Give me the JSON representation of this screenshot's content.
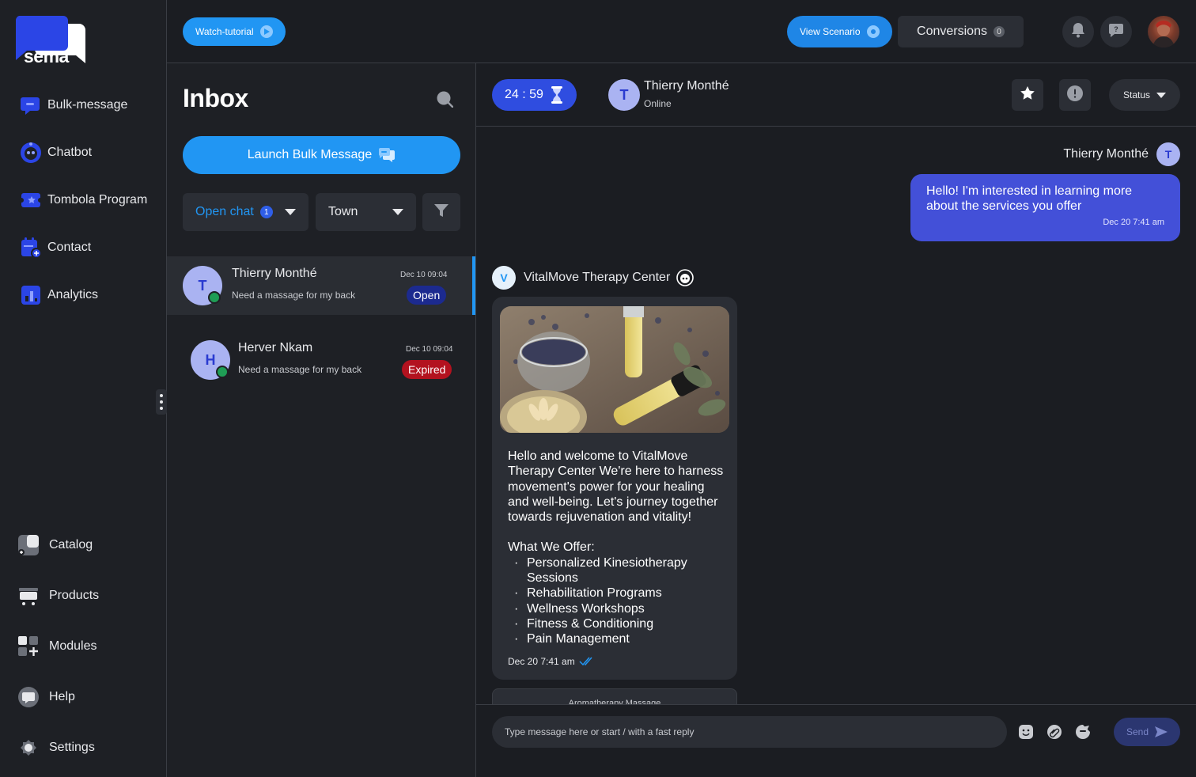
{
  "brand": {
    "logo_text": "sema",
    "accent": "#2196f3"
  },
  "sidebar": {
    "items": [
      {
        "label": "Bulk-message",
        "icon": "bulk-message-icon"
      },
      {
        "label": "Chatbot",
        "icon": "chatbot-icon"
      },
      {
        "label": "Tombola Program",
        "icon": "tombola-icon"
      },
      {
        "label": "Contact",
        "icon": "contact-icon"
      },
      {
        "label": "Analytics",
        "icon": "analytics-icon"
      }
    ],
    "bottom_items": [
      {
        "label": "Catalog",
        "icon": "catalog-icon"
      },
      {
        "label": "Products",
        "icon": "cart-icon"
      },
      {
        "label": "Modules",
        "icon": "modules-icon"
      },
      {
        "label": "Help",
        "icon": "help-icon"
      },
      {
        "label": "Settings",
        "icon": "gear-icon"
      }
    ]
  },
  "topbar": {
    "watch_tutorial": "Watch-tutorial",
    "view_scenario": "View Scenario",
    "conversions_label": "Conversions",
    "conversions_count": "0"
  },
  "inbox": {
    "title": "Inbox",
    "launch_label": "Launch Bulk Message",
    "filter_status": "Open chat",
    "filter_status_count": "1",
    "filter_town": "Town",
    "chats": [
      {
        "initial": "T",
        "name": "Thierry Monthé",
        "preview": "Need a massage for my back",
        "time": "Dec 10 09:04",
        "status": "Open"
      },
      {
        "initial": "H",
        "name": "Herver Nkam",
        "preview": "Need a massage for my back",
        "time": "Dec 10 09:04",
        "status": "Expired"
      }
    ]
  },
  "chat": {
    "timer": "24 : 59",
    "contact_initial": "T",
    "contact_name": "Thierry Monthé",
    "contact_status": "Online",
    "status_label": "Status",
    "outgoing": {
      "sender": "Thierry Monthé",
      "initial": "T",
      "text": "Hello! I'm interested in learning more about the services you offer",
      "time": "Dec 20 7:41 am"
    },
    "incoming": {
      "sender": "VitalMove Therapy Center",
      "initial": "V",
      "intro": "Hello and welcome to VitalMove Therapy Center We're here to harness movement's power for your healing and well-being. Let's journey together towards rejuvenation and vitality!",
      "offer_title": "What We Offer:",
      "offers": [
        "Personalized Kinesiotherapy Sessions",
        "Rehabilitation Programs",
        "Wellness Workshops",
        "Fitness & Conditioning",
        "Pain Management"
      ],
      "time": "Dec 20 7:41 am"
    },
    "next_card_title": "Aromatherapy Massage",
    "composer_placeholder": "Type message here or start / with a fast reply",
    "send_label": "Send"
  }
}
